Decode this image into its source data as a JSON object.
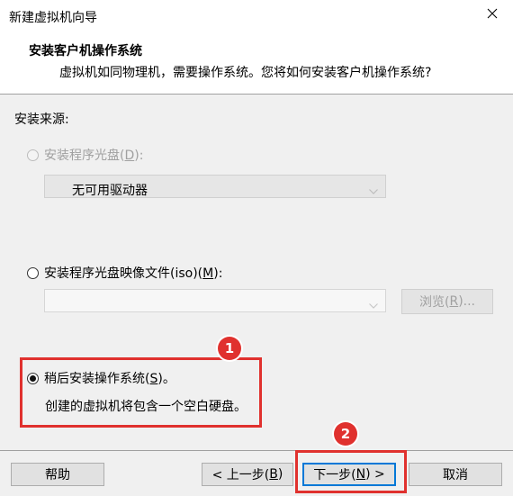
{
  "window": {
    "title": "新建虚拟机向导"
  },
  "header": {
    "title": "安装客户机操作系统",
    "subtitle": "虚拟机如同物理机，需要操作系统。您将如何安装客户机操作系统?"
  },
  "install_source": {
    "label": "安装来源:",
    "options": [
      {
        "label_pre": "安装程序光盘(",
        "hotkey": "D",
        "label_post": "):",
        "selected": false,
        "enabled": false
      },
      {
        "label_pre": "安装程序光盘映像文件(iso)(",
        "hotkey": "M",
        "label_post": "):",
        "selected": false,
        "enabled": true
      },
      {
        "label_pre": "稍后安装操作系统(",
        "hotkey": "S",
        "label_post": ")。",
        "selected": true,
        "enabled": true
      }
    ],
    "drive_select": {
      "value": "无可用驱动器"
    },
    "iso_select": {
      "value": ""
    },
    "browse_button": {
      "label_pre": "浏览(",
      "hotkey": "R",
      "label_post": ")..."
    },
    "later_description": "创建的虚拟机将包含一个空白硬盘。"
  },
  "footer": {
    "help": "帮助",
    "back": {
      "label_pre": "< 上一步(",
      "hotkey": "B",
      "label_post": ")"
    },
    "next": {
      "label_pre": "下一步(",
      "hotkey": "N",
      "label_post": ") >"
    },
    "cancel": "取消"
  },
  "annotations": [
    {
      "number": "1"
    },
    {
      "number": "2"
    }
  ],
  "colors": {
    "highlight": "#e0312e",
    "focus": "#0078d7"
  }
}
